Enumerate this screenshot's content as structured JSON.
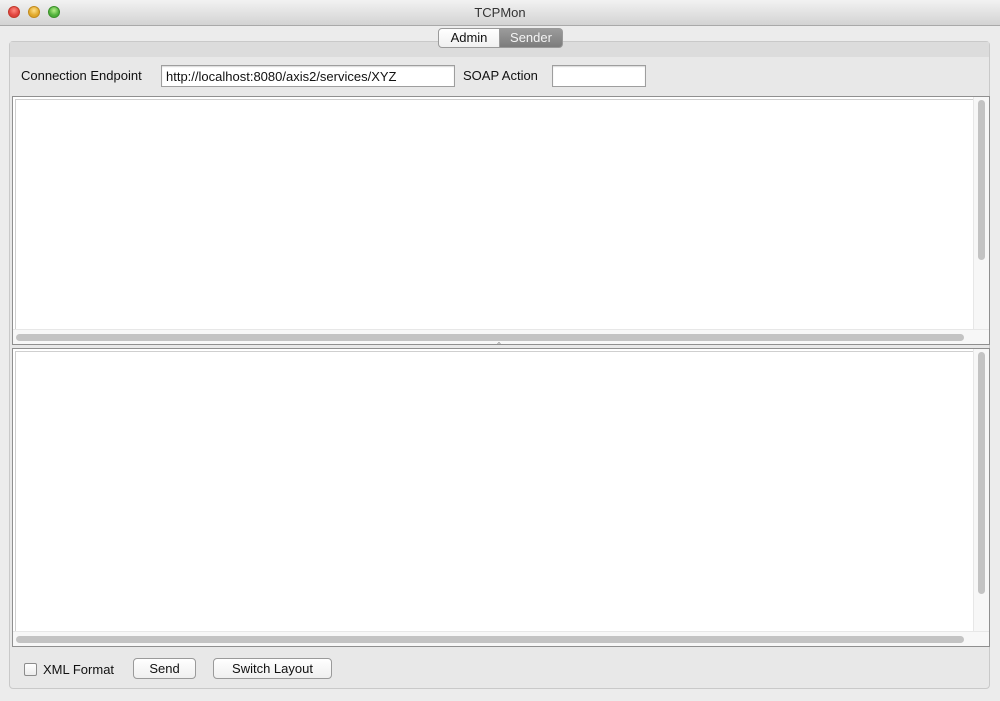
{
  "window": {
    "title": "TCPMon"
  },
  "tabs": [
    {
      "label": "Admin",
      "selected": false
    },
    {
      "label": "Sender",
      "selected": true
    }
  ],
  "sender": {
    "endpoint_label": "Connection Endpoint",
    "endpoint_value": "http://localhost:8080/axis2/services/XYZ",
    "soap_action_label": "SOAP Action",
    "soap_action_value": "",
    "request_text": "",
    "response_text": "",
    "xml_format_label": "XML Format",
    "xml_format_checked": false,
    "send_label": "Send",
    "switch_layout_label": "Switch Layout"
  },
  "colors": {
    "selected_tab": "#8a8a8a",
    "window_bg": "#ececec"
  }
}
